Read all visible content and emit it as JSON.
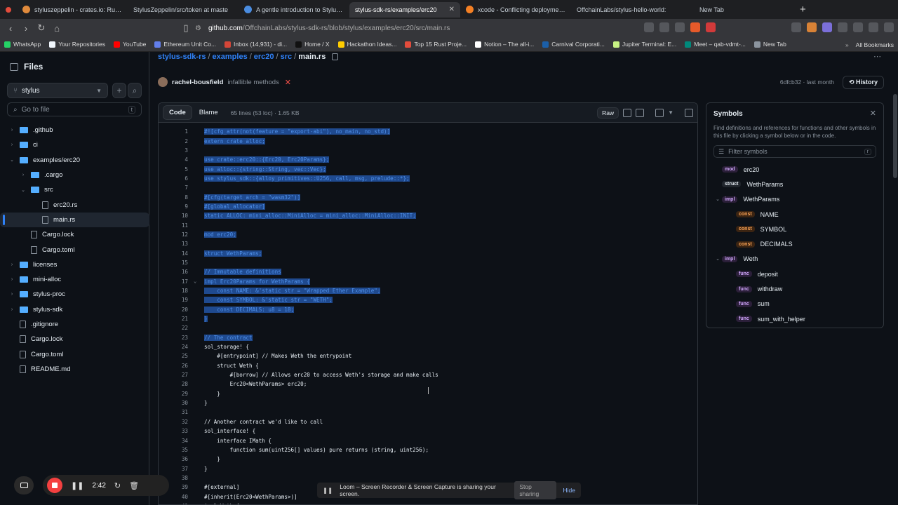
{
  "browser": {
    "tabs": [
      {
        "label": "styluszeppelin - crates.io: Rust Pa",
        "icon": "rust"
      },
      {
        "label": "StylusZeppelin/src/token at maste",
        "icon": "gh"
      },
      {
        "label": "A gentle introduction to Stylus | A",
        "icon": "arb"
      },
      {
        "label": "stylus-sdk-rs/examples/erc20",
        "icon": "gh",
        "active": true
      },
      {
        "label": "xcode - Conflicting deployment ta",
        "icon": "xc"
      },
      {
        "label": "OffchainLabs/stylus-hello-world:",
        "icon": "gh"
      },
      {
        "label": "New Tab",
        "icon": "none"
      }
    ],
    "url_host": "github.com",
    "url_path": "/OffchainLabs/stylus-sdk-rs/blob/stylus/examples/erc20/src/main.rs",
    "bookmarks": [
      "WhatsApp",
      "Your Repositories",
      "YouTube",
      "Ethereum Unit Co...",
      "Inbox (14,931) - di...",
      "Home / X",
      "Hackathon Ideas...",
      "Top 15 Rust Proje...",
      "Notion – The all-i...",
      "Carnival Corporati...",
      "Jupiter Terminal: E...",
      "Meet – qab-vdmt-...",
      "New Tab"
    ],
    "all_bookmarks": "All Bookmarks"
  },
  "sidebar": {
    "title": "Files",
    "branch": "stylus",
    "goto_placeholder": "Go to file",
    "goto_kbd": "t",
    "items": [
      {
        "label": ".github",
        "type": "folder",
        "depth": 0,
        "chev": "›"
      },
      {
        "label": "ci",
        "type": "folder",
        "depth": 0,
        "chev": "›"
      },
      {
        "label": "examples/erc20",
        "type": "folder",
        "depth": 0,
        "chev": "⌄"
      },
      {
        "label": ".cargo",
        "type": "folder",
        "depth": 1,
        "chev": "›"
      },
      {
        "label": "src",
        "type": "folder",
        "depth": 1,
        "chev": "⌄"
      },
      {
        "label": "erc20.rs",
        "type": "file",
        "depth": 2,
        "chev": ""
      },
      {
        "label": "main.rs",
        "type": "file",
        "depth": 2,
        "chev": "",
        "selected": true
      },
      {
        "label": "Cargo.lock",
        "type": "file",
        "depth": 1,
        "chev": ""
      },
      {
        "label": "Cargo.toml",
        "type": "file",
        "depth": 1,
        "chev": ""
      },
      {
        "label": "licenses",
        "type": "folder",
        "depth": 0,
        "chev": "›"
      },
      {
        "label": "mini-alloc",
        "type": "folder",
        "depth": 0,
        "chev": "›"
      },
      {
        "label": "stylus-proc",
        "type": "folder",
        "depth": 0,
        "chev": "›"
      },
      {
        "label": "stylus-sdk",
        "type": "folder",
        "depth": 0,
        "chev": "›"
      },
      {
        "label": ".gitignore",
        "type": "file",
        "depth": 0,
        "chev": ""
      },
      {
        "label": "Cargo.lock",
        "type": "file",
        "depth": 0,
        "chev": ""
      },
      {
        "label": "Cargo.toml",
        "type": "file",
        "depth": 0,
        "chev": ""
      },
      {
        "label": "README.md",
        "type": "file",
        "depth": 0,
        "chev": ""
      }
    ]
  },
  "breadcrumb": {
    "parts": [
      "stylus-sdk-rs",
      "examples",
      "erc20",
      "src"
    ],
    "current": "main.rs"
  },
  "commit": {
    "author": "rachel-bousfield",
    "message": "infallible methods",
    "status": "✕",
    "hash_time": "6dfcb32 · last month",
    "history": "History"
  },
  "code": {
    "tab_code": "Code",
    "tab_blame": "Blame",
    "meta": "65 lines (53 loc) · 1.65 KB",
    "raw": "Raw",
    "lines": [
      {
        "n": "1",
        "t": "#![cfg_attr(not(feature = \"export-abi\"), no_main, no_std)]",
        "hl": true
      },
      {
        "n": "2",
        "t": "extern crate alloc;",
        "hl": true
      },
      {
        "n": "3",
        "t": "",
        "hl": true
      },
      {
        "n": "4",
        "t": "use crate::erc20::{Erc20, Erc20Params};",
        "hl": true
      },
      {
        "n": "5",
        "t": "use alloc::{string::String, vec::Vec};",
        "hl": true
      },
      {
        "n": "6",
        "t": "use stylus_sdk::{alloy_primitives::U256, call, msg, prelude::*};",
        "hl": true
      },
      {
        "n": "7",
        "t": "",
        "hl": true
      },
      {
        "n": "8",
        "t": "#[cfg(target_arch = \"wasm32\")]",
        "hl": true
      },
      {
        "n": "9",
        "t": "#[global_allocator]",
        "hl": true
      },
      {
        "n": "10",
        "t": "static ALLOC: mini_alloc::MiniAlloc = mini_alloc::MiniAlloc::INIT;",
        "hl": true
      },
      {
        "n": "11",
        "t": "",
        "hl": true
      },
      {
        "n": "12",
        "t": "mod erc20;",
        "hl": true
      },
      {
        "n": "13",
        "t": "",
        "hl": true
      },
      {
        "n": "14",
        "t": "struct WethParams;",
        "hl": true
      },
      {
        "n": "15",
        "t": "",
        "hl": true
      },
      {
        "n": "16",
        "t": "// Immutable definitions",
        "hl": true
      },
      {
        "n": "17",
        "t": "impl Erc20Params for WethParams {",
        "hl": true,
        "fold": "⌄"
      },
      {
        "n": "18",
        "t": "    const NAME: &'static str = \"Wrapped Ether Example\";",
        "hl": true
      },
      {
        "n": "19",
        "t": "    const SYMBOL: &'static str = \"WETH\";",
        "hl": true
      },
      {
        "n": "20",
        "t": "    const DECIMALS: u8 = 18;",
        "hl": true
      },
      {
        "n": "21",
        "t": "}",
        "hl": true
      },
      {
        "n": "22",
        "t": "",
        "hl": true
      },
      {
        "n": "23",
        "t": "// The contract",
        "hl": true
      },
      {
        "n": "24",
        "t": "sol_storage! {",
        "hl": false
      },
      {
        "n": "25",
        "t": "    #[entrypoint] // Makes Weth the entrypoint",
        "hl": false
      },
      {
        "n": "26",
        "t": "    struct Weth {",
        "hl": false
      },
      {
        "n": "27",
        "t": "        #[borrow] // Allows erc20 to access Weth's storage and make calls",
        "hl": false
      },
      {
        "n": "28",
        "t": "        Erc20<WethParams> erc20;",
        "hl": false
      },
      {
        "n": "29",
        "t": "    }",
        "hl": false
      },
      {
        "n": "30",
        "t": "}",
        "hl": false
      },
      {
        "n": "31",
        "t": "",
        "hl": false
      },
      {
        "n": "32",
        "t": "// Another contract we'd like to call",
        "hl": false
      },
      {
        "n": "33",
        "t": "sol_interface! {",
        "hl": false
      },
      {
        "n": "34",
        "t": "    interface IMath {",
        "hl": false
      },
      {
        "n": "35",
        "t": "        function sum(uint256[] values) pure returns (string, uint256);",
        "hl": false
      },
      {
        "n": "36",
        "t": "    }",
        "hl": false
      },
      {
        "n": "37",
        "t": "}",
        "hl": false
      },
      {
        "n": "38",
        "t": "",
        "hl": false
      },
      {
        "n": "39",
        "t": "#[external]",
        "hl": false
      },
      {
        "n": "40",
        "t": "#[inherit(Erc20<WethParams>)]",
        "hl": false
      },
      {
        "n": "41",
        "t": "impl Weth {",
        "hl": false,
        "fold": "⌄"
      }
    ]
  },
  "symbols": {
    "title": "Symbols",
    "description": "Find definitions and references for functions and other symbols in this file by clicking a symbol below or in the code.",
    "filter_placeholder": "Filter symbols",
    "filter_kbd": "r",
    "items": [
      {
        "kind": "mod",
        "name": "erc20",
        "depth": 0
      },
      {
        "kind": "struct",
        "name": "WethParams",
        "depth": 0
      },
      {
        "kind": "impl",
        "name": "WethParams",
        "depth": 0,
        "chev": "⌄"
      },
      {
        "kind": "const",
        "name": "NAME",
        "depth": 1
      },
      {
        "kind": "const",
        "name": "SYMBOL",
        "depth": 1
      },
      {
        "kind": "const",
        "name": "DECIMALS",
        "depth": 1
      },
      {
        "kind": "impl",
        "name": "Weth",
        "depth": 0,
        "chev": "⌄"
      },
      {
        "kind": "func",
        "name": "deposit",
        "depth": 1
      },
      {
        "kind": "func",
        "name": "withdraw",
        "depth": 1
      },
      {
        "kind": "func",
        "name": "sum",
        "depth": 1
      },
      {
        "kind": "func",
        "name": "sum_with_helper",
        "depth": 1
      }
    ]
  },
  "loom": {
    "timer": "2:42",
    "share_text": "Loom – Screen Recorder & Screen Capture is sharing your screen.",
    "stop": "Stop sharing",
    "hide": "Hide"
  }
}
